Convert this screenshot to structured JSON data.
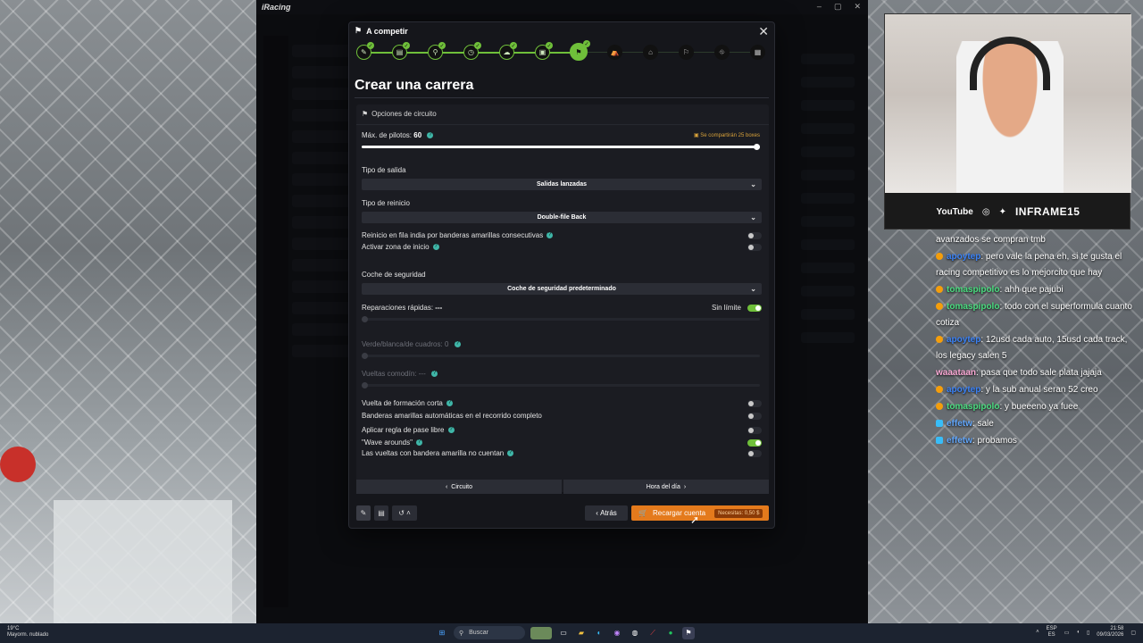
{
  "app": {
    "logo": "iRacing",
    "window_controls": [
      "–",
      "▢",
      "✕"
    ]
  },
  "modal": {
    "header": "A competir",
    "close": "✕",
    "title": "Crear una carrera",
    "steps": [
      {
        "icon": "✎",
        "done": true
      },
      {
        "icon": "▤",
        "done": true
      },
      {
        "icon": "⚲",
        "done": true
      },
      {
        "icon": "◷",
        "done": true
      },
      {
        "icon": "☁",
        "done": true
      },
      {
        "icon": "▣",
        "done": true
      },
      {
        "icon": "⚑",
        "done": false,
        "current": true
      },
      {
        "icon": "⛺",
        "done": false
      },
      {
        "icon": "⌂",
        "done": false
      },
      {
        "icon": "⚐",
        "done": false
      },
      {
        "icon": "⛗",
        "done": false
      },
      {
        "icon": "▦",
        "done": false
      }
    ],
    "panel": {
      "header": "Opciones de circuito",
      "max_drivers_label": "Máx. de pilotos:",
      "max_drivers_value": "60",
      "max_drivers_fraction": 1.0,
      "pit_badge": "Se compartirán 25 boxes",
      "start_type_label": "Tipo de salida",
      "start_type_value": "Salidas lanzadas",
      "restart_type_label": "Tipo de reinicio",
      "restart_type_value": "Double-file Back",
      "single_file_label": "Reinicio en fila india por banderas amarillas consecutivas",
      "start_zone_label": "Activar zona de inicio",
      "safety_car_label": "Coche de seguridad",
      "safety_car_value": "Coche de seguridad predeterminado",
      "fast_repairs_label": "Reparaciones rápidas:",
      "fast_repairs_value": "---",
      "unlimited_label": "Sin límite",
      "gwc_label": "Verde/blanca/de cuadros:",
      "gwc_value": "0",
      "joker_label": "Vueltas comodín:",
      "joker_value": "---",
      "short_formation_label": "Vuelta de formación corta",
      "auto_yellow_label": "Banderas amarillas automáticas en el recorrido completo",
      "free_pass_label": "Aplicar regla de pase libre",
      "wave_arounds_label": "\"Wave arounds\"",
      "yellow_laps_label": "Las vueltas con bandera amarilla no cuentan"
    },
    "nav": {
      "prev": "Circuito",
      "next": "Hora del día"
    },
    "footer": {
      "back": "Atrás",
      "recharge": "Recargar cuenta",
      "need": "Necesitas: 0,50 $"
    }
  },
  "stream": {
    "brand": "INFRAME15",
    "youtube": "YouTube",
    "chat": [
      {
        "user": "",
        "text": "avanzados se compran tmb",
        "color": "#ffffff"
      },
      {
        "user": "apoytep",
        "text": ": pero vale la pena eh, si te gusta el racing competitivo es lo mejorcito que hay",
        "color": "#3b82f6"
      },
      {
        "user": "tomaspipolo",
        "text": ": ahh que pajubi",
        "color": "#4ade80"
      },
      {
        "user": "tomaspipolo",
        "text": ": todo con el superformula cuanto cotiza",
        "color": "#4ade80"
      },
      {
        "user": "apoytep",
        "text": ": 12usd cada auto, 15usd cada track, los legacy salen 5",
        "color": "#3b82f6"
      },
      {
        "user": "waaataan",
        "text": ": pasa que todo sale plata jajaja",
        "color": "#f9a8d4"
      },
      {
        "user": "apoytep",
        "text": ": y la sub anual seran 52 creo",
        "color": "#3b82f6"
      },
      {
        "user": "tomaspipolo",
        "text": ": y bueeeno ya fuee",
        "color": "#4ade80"
      },
      {
        "user": "effetw",
        "text": ": sale",
        "color": "#60a5fa"
      },
      {
        "user": "effetw",
        "text": ": probamos",
        "color": "#60a5fa"
      }
    ]
  },
  "taskbar": {
    "weather_temp": "19°C",
    "weather_desc": "Mayorm. nublado",
    "search": "Buscar",
    "lang": "ESP",
    "lang2": "ES",
    "time": "21:58",
    "date": "09/03/2026"
  }
}
